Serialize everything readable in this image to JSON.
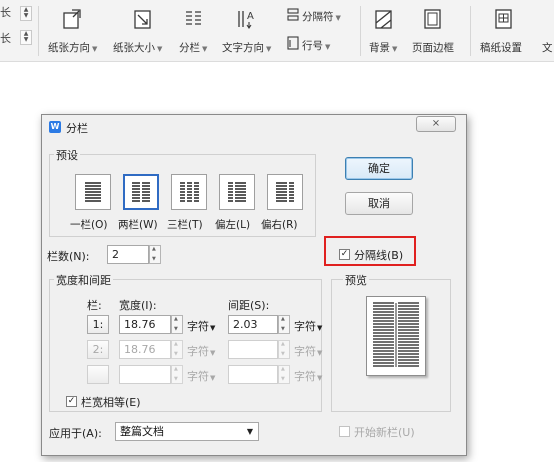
{
  "ribbon": {
    "cut_left_top": "长",
    "cut_left_bottom": "长",
    "orientation_label": "纸张方向",
    "paper_size_label": "纸张大小",
    "columns_label": "分栏",
    "text_direction_label": "文字方向",
    "separator_label": "分隔符",
    "line_number_label": "行号",
    "background_label": "背景",
    "page_border_label": "页面边框",
    "manuscript_label": "稿纸设置",
    "cut_right": "文"
  },
  "dialog": {
    "title": "分栏",
    "close_symbol": "⨯",
    "presets_group_label": "预设",
    "presets": [
      {
        "label": "一栏(O)"
      },
      {
        "label": "两栏(W)"
      },
      {
        "label": "三栏(T)"
      },
      {
        "label": "偏左(L)"
      },
      {
        "label": "偏右(R)"
      }
    ],
    "ok_label": "确定",
    "cancel_label": "取消",
    "column_count_label": "栏数(N):",
    "column_count_value": "2",
    "separator_checkbox_label": "分隔线(B)",
    "separator_checked": true,
    "width_spacing_group_label": "宽度和间距",
    "col_header": "栏:",
    "width_header": "宽度(I):",
    "spacing_header": "间距(S):",
    "rows": [
      {
        "num": "1:",
        "width": "18.76",
        "width_unit": "字符",
        "spacing": "2.03",
        "spacing_unit": "字符",
        "enabled": true
      },
      {
        "num": "2:",
        "width": "18.76",
        "width_unit": "字符",
        "spacing": "",
        "spacing_unit": "字符",
        "enabled": false
      },
      {
        "num": "",
        "width": "",
        "width_unit": "字符",
        "spacing": "",
        "spacing_unit": "字符",
        "enabled": false
      }
    ],
    "equal_width_label": "栏宽相等(E)",
    "equal_width_checked": true,
    "preview_group_label": "预览",
    "apply_to_label": "应用于(A):",
    "apply_to_value": "整篇文档",
    "new_column_label": "开始新栏(U)",
    "new_column_checked": false
  }
}
